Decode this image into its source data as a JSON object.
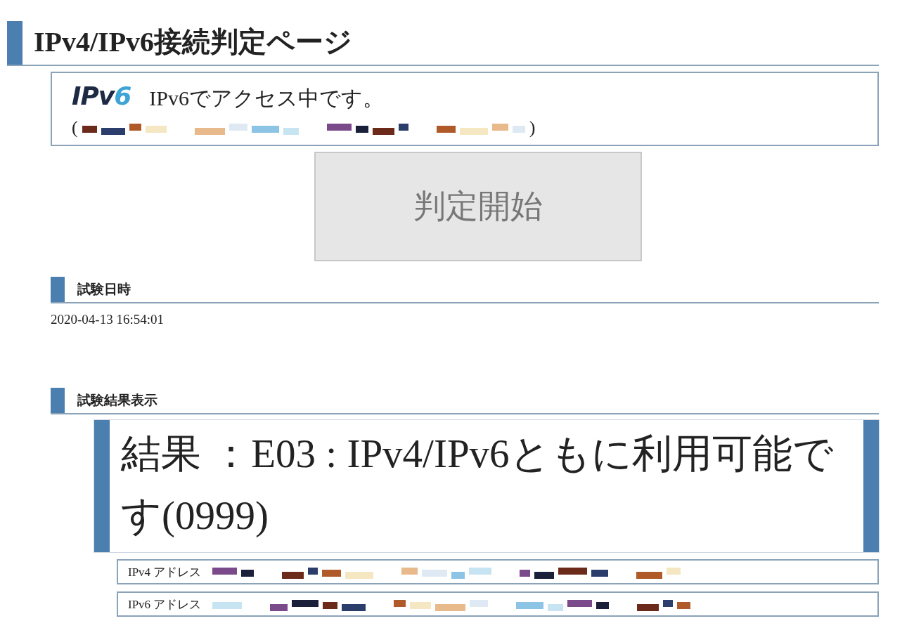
{
  "title": "IPv4/IPv6接続判定ページ",
  "access": {
    "logo_main": "IPv",
    "logo_digit": "6",
    "message": "IPv6でアクセス中です。",
    "open_paren": "(",
    "close_paren": ")"
  },
  "start_button": "判定開始",
  "sections": [
    {
      "heading": "試験日時"
    },
    {
      "heading": "試験結果表示"
    }
  ],
  "test_time": "2020-04-13 16:54:01",
  "result": "結果 ：E03 : IPv4/IPv6ともに利用可能です(0999)",
  "addresses": [
    {
      "label": "IPv4 アドレス"
    },
    {
      "label": "IPv6 アドレス"
    }
  ]
}
